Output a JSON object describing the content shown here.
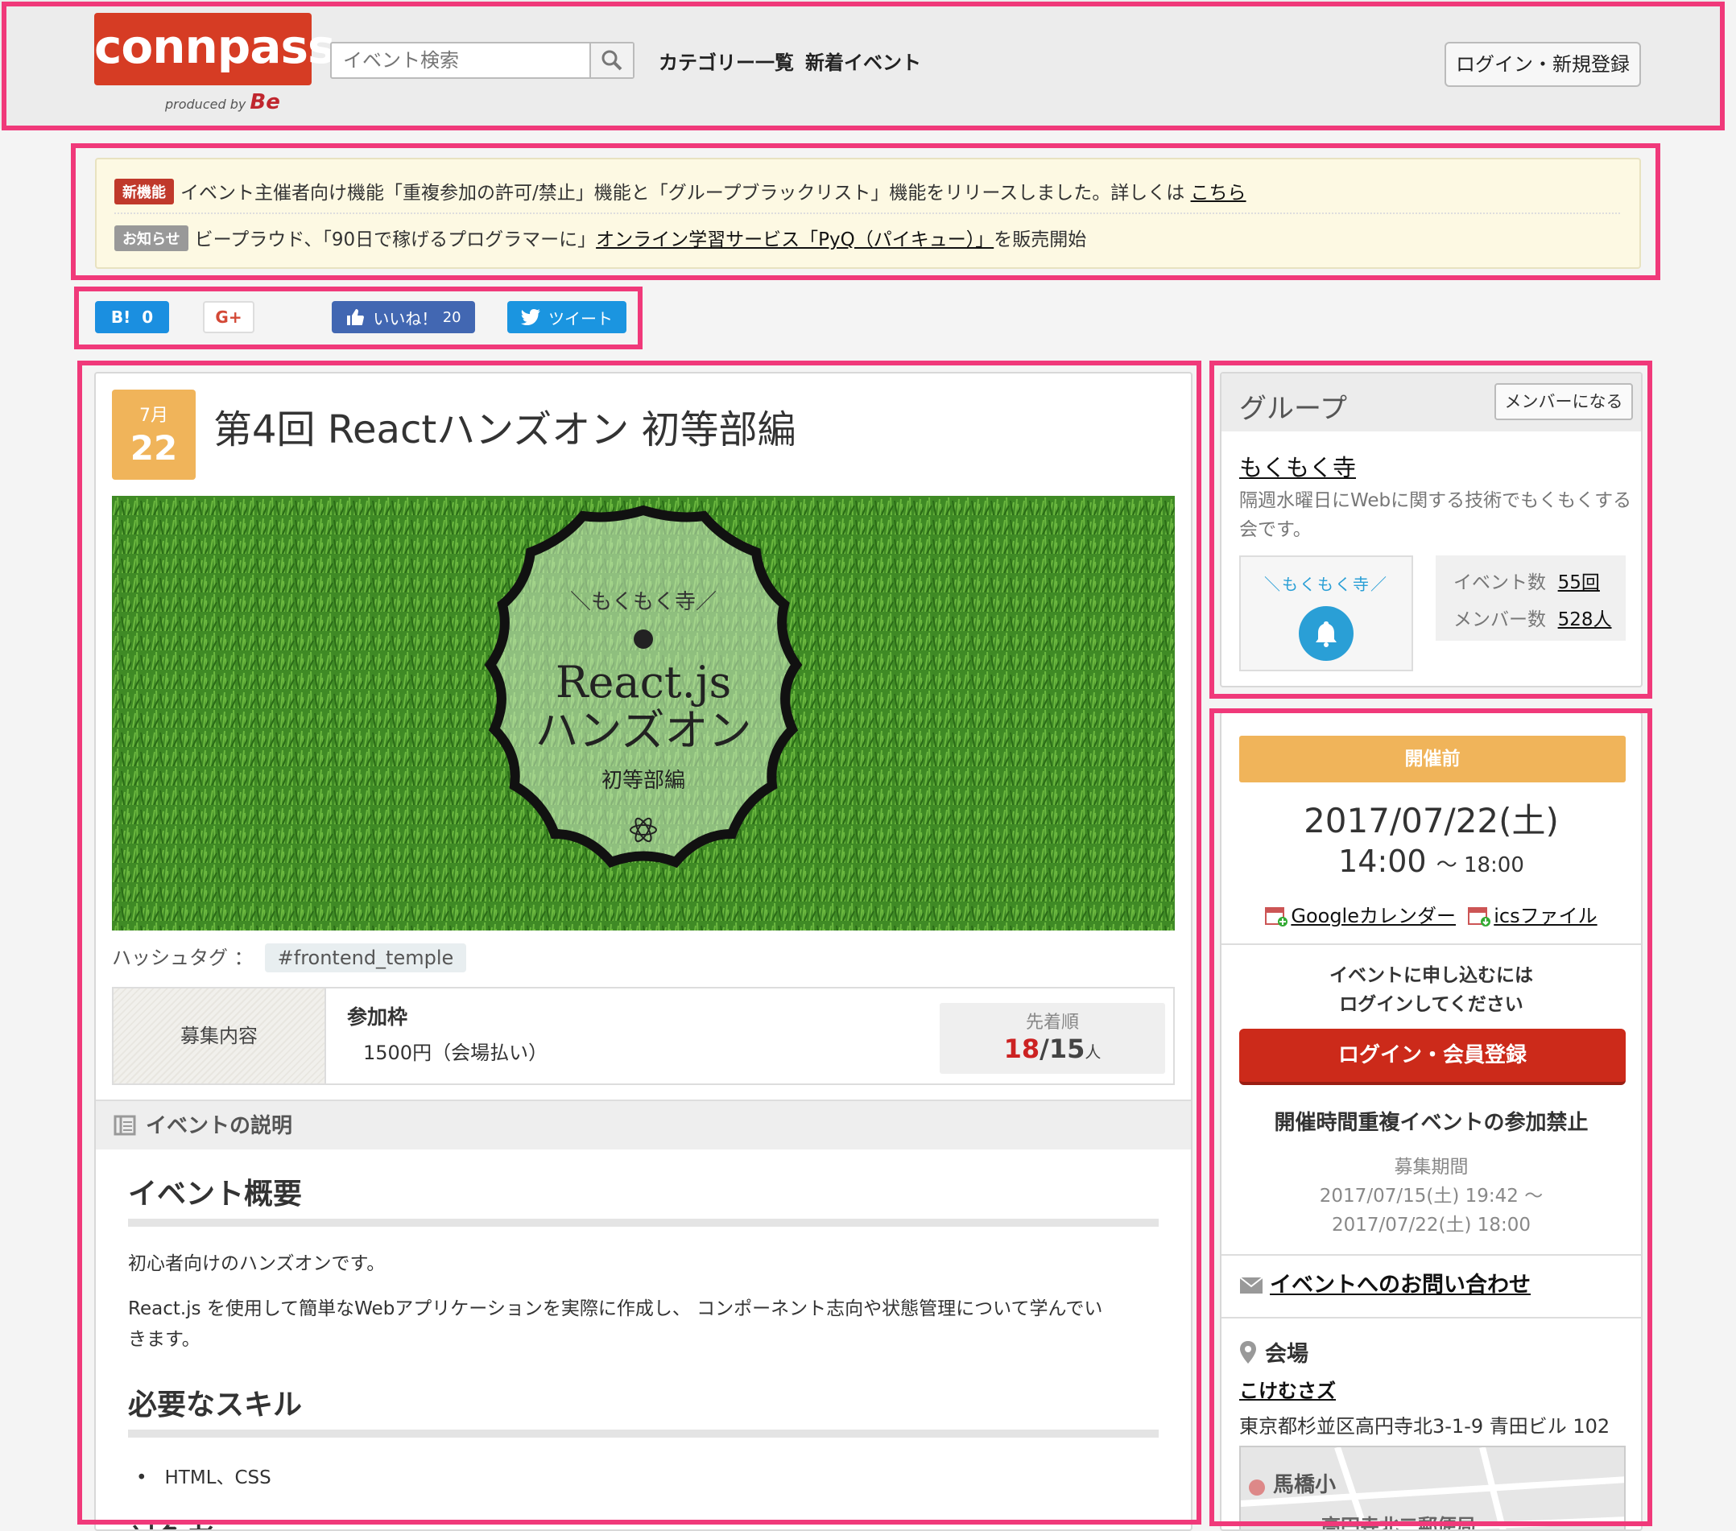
{
  "header": {
    "logo_text": "connpass",
    "logo_sub": "produced by",
    "logo_brand": "Be",
    "search_placeholder": "イベント検索",
    "nav": [
      "カテゴリー一覧",
      "新着イベント"
    ],
    "login_label": "ログイン・新規登録"
  },
  "notice": {
    "row1_tag": "新機能",
    "row1_text": "イベント主催者向け機能「重複参加の許可/禁止」機能と「グループブラックリスト」機能をリリースしました。詳しくは",
    "row1_link": "こちら",
    "row2_tag": "お知らせ",
    "row2_text": "ビープラウド、「90日で稼げるプログラマーに」",
    "row2_link": "オンライン学習サービス「PyQ（パイキュー）」",
    "row2_tail": "を販売開始"
  },
  "share": {
    "hatena": "B!",
    "hatena_count": "0",
    "gplus": "G+",
    "like": "いいね！",
    "like_count": "20",
    "tweet": "ツイート"
  },
  "event": {
    "month": "7月",
    "day": "22",
    "title": "第4回 Reactハンズオン 初等部編",
    "image_caption_top": "＼もくもく寺／",
    "image_caption_main1": "React.js",
    "image_caption_main2": "ハンズオン",
    "image_caption_sub": "初等部編",
    "hashtag_label": "ハッシュタグ ：",
    "hashtag": "#frontend_temple",
    "recruit_label": "募集内容",
    "slot_name": "参加枠",
    "slot_price": "1500円（会場払い）",
    "slot_order": "先着順",
    "slot_taken": "18",
    "slot_sep": "/",
    "slot_capacity": "15",
    "slot_unit": "人",
    "desc_head": "イベントの説明",
    "overview_title": "イベント概要",
    "overview_p1": "初心者向けのハンズオンです。",
    "overview_p2": "React.js を使用して簡単なWebアプリケーションを実際に作成し、 コンポーネント志向や状態管理について学んでい",
    "overview_p2b": "きます。",
    "skills_title": "必要なスキル",
    "skills_item": "HTML、CSS",
    "cut_title": "対象者"
  },
  "group": {
    "title": "グループ",
    "member_button": "メンバーになる",
    "name": "もくもく寺",
    "description": "隔週水曜日にWebに関する技術でもくもくする会です。",
    "logo_text": "＼もくもく寺／",
    "events_label": "イベント数",
    "events_value": "55回",
    "members_label": "メンバー数",
    "members_value": "528人"
  },
  "info": {
    "status": "開催前",
    "date": "2017/07/22(土)",
    "time_start": "14:00",
    "time_end": "〜 18:00",
    "google_calendar": "Googleカレンダー",
    "ics": "icsファイル",
    "apply_note1": "イベントに申し込むには",
    "apply_note2": "ログインしてください",
    "apply_button": "ログイン・会員登録",
    "overlap": "開催時間重複イベントの参加禁止",
    "period_label": "募集期間",
    "period_start": "2017/07/15(土) 19:42 〜",
    "period_end": "2017/07/22(土) 18:00",
    "contact": "イベントへのお問い合わせ",
    "venue_label": "会場",
    "venue_name": "こけむさズ",
    "venue_address": "東京都杉並区高円寺北3-1-9 青田ビル 102",
    "map_label1": "馬橋小",
    "map_label2": "高円寺北二郵便局"
  },
  "colors": {
    "highlight": "#f0397a",
    "brand": "#d63c24",
    "accent_orange": "#f0b45a",
    "apply_red": "#cc2a1a"
  }
}
